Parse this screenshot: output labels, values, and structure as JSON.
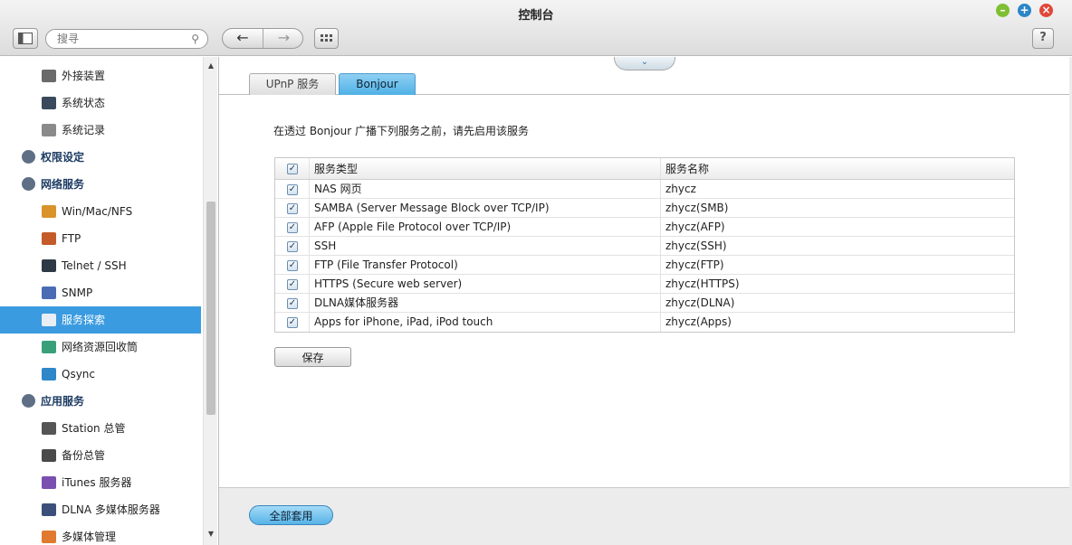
{
  "window": {
    "title": "控制台"
  },
  "toolbar": {
    "search_placeholder": "搜寻",
    "help_label": "?"
  },
  "sidebar": {
    "items": [
      {
        "label": "外接装置",
        "kind": "sub",
        "icon": "external-device-icon",
        "color": "#6a6a6a"
      },
      {
        "label": "系统状态",
        "kind": "sub",
        "icon": "monitor-icon",
        "color": "#3a4a5c"
      },
      {
        "label": "系统记录",
        "kind": "sub",
        "icon": "log-icon",
        "color": "#8a8a8a"
      },
      {
        "label": "权限设定",
        "kind": "cat",
        "icon": "user-icon",
        "color": "#5f6f85"
      },
      {
        "label": "网络服务",
        "kind": "cat",
        "icon": "globe-icon",
        "color": "#5f6f85"
      },
      {
        "label": "Win/Mac/NFS",
        "kind": "sub",
        "icon": "os-icon",
        "color": "#d9932b"
      },
      {
        "label": "FTP",
        "kind": "sub",
        "icon": "ftp-icon",
        "color": "#c45b2a"
      },
      {
        "label": "Telnet / SSH",
        "kind": "sub",
        "icon": "terminal-icon",
        "color": "#2d3a46"
      },
      {
        "label": "SNMP",
        "kind": "sub",
        "icon": "chart-icon",
        "color": "#4b6cb5"
      },
      {
        "label": "服务探索",
        "kind": "sub",
        "icon": "discovery-icon",
        "color": "#e8eef5",
        "active": true
      },
      {
        "label": "网络资源回收筒",
        "kind": "sub",
        "icon": "recycle-bin-icon",
        "color": "#3aa07a"
      },
      {
        "label": "Qsync",
        "kind": "sub",
        "icon": "qsync-icon",
        "color": "#2f86c9"
      },
      {
        "label": "应用服务",
        "kind": "cat",
        "icon": "apps-icon",
        "color": "#5f6f85"
      },
      {
        "label": "Station 总管",
        "kind": "sub",
        "icon": "station-icon",
        "color": "#555555"
      },
      {
        "label": "备份总管",
        "kind": "sub",
        "icon": "backup-icon",
        "color": "#4a4a4a"
      },
      {
        "label": "iTunes 服务器",
        "kind": "sub",
        "icon": "itunes-icon",
        "color": "#7a4fb0"
      },
      {
        "label": "DLNA 多媒体服务器",
        "kind": "sub",
        "icon": "dlna-icon",
        "color": "#3b4f7a"
      },
      {
        "label": "多媒体管理",
        "kind": "sub",
        "icon": "multimedia-icon",
        "color": "#e07a2e"
      }
    ]
  },
  "tabs": [
    {
      "label": "UPnP 服务",
      "active": false
    },
    {
      "label": "Bonjour",
      "active": true
    }
  ],
  "main": {
    "intro": "在透过 Bonjour 广播下列服务之前，请先启用该服务",
    "table": {
      "columns": [
        "服务类型",
        "服务名称"
      ],
      "header_checked": true,
      "rows": [
        {
          "type": "NAS 网页",
          "name": "zhycz",
          "checked": true
        },
        {
          "type": "SAMBA (Server Message Block over TCP/IP)",
          "name": "zhycz(SMB)",
          "checked": true
        },
        {
          "type": "AFP (Apple File Protocol over TCP/IP)",
          "name": "zhycz(AFP)",
          "checked": true
        },
        {
          "type": "SSH",
          "name": "zhycz(SSH)",
          "checked": true
        },
        {
          "type": "FTP (File Transfer Protocol)",
          "name": "zhycz(FTP)",
          "checked": true
        },
        {
          "type": "HTTPS (Secure web server)",
          "name": "zhycz(HTTPS)",
          "checked": true
        },
        {
          "type": "DLNA媒体服务器",
          "name": "zhycz(DLNA)",
          "checked": true
        },
        {
          "type": "Apps for iPhone, iPad, iPod touch",
          "name": "zhycz(Apps)",
          "checked": true
        }
      ]
    },
    "save_label": "保存"
  },
  "footer": {
    "apply_all_label": "全部套用"
  },
  "colors": {
    "accent": "#3a9be0",
    "tab_active": "#4fb1e5",
    "category_text": "#1c3b63"
  }
}
